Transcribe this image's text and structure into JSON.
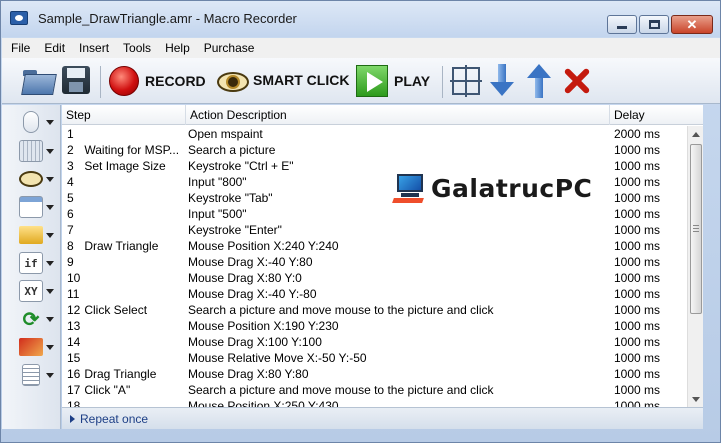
{
  "window": {
    "title": "Sample_DrawTriangle.amr - Macro Recorder",
    "controls": {
      "minimize": "minimize",
      "maximize": "maximize",
      "close": "✕"
    }
  },
  "menu": [
    "File",
    "Edit",
    "Insert",
    "Tools",
    "Help",
    "Purchase"
  ],
  "toolbar": {
    "open_icon": "folder-open-icon",
    "save_icon": "save-icon",
    "record_label": "RECORD",
    "smart_click_label": "SMART CLICK",
    "play_label": "PLAY",
    "select_icon": "select-icon",
    "move_down_icon": "arrow-down-icon",
    "move_up_icon": "arrow-up-icon",
    "delete_icon": "delete-icon"
  },
  "left_panel": {
    "buttons": [
      {
        "name": "mouse-icon",
        "glyph": ""
      },
      {
        "name": "keyboard-icon",
        "glyph": ""
      },
      {
        "name": "eye-icon",
        "glyph": ""
      },
      {
        "name": "window-icon",
        "glyph": ""
      },
      {
        "name": "folder-icon",
        "glyph": ""
      },
      {
        "name": "if-icon",
        "glyph": "if"
      },
      {
        "name": "xy-icon",
        "glyph": "XY"
      },
      {
        "name": "loop-icon",
        "glyph": "⟳"
      },
      {
        "name": "flag-icon",
        "glyph": ""
      },
      {
        "name": "note-icon",
        "glyph": ""
      }
    ]
  },
  "table": {
    "headers": {
      "step": "Step",
      "action": "Action Description",
      "delay": "Delay"
    },
    "rows": [
      {
        "num": "1",
        "label": "",
        "action": "Open mspaint",
        "delay": "2000 ms"
      },
      {
        "num": "2",
        "label": "Waiting for MSP...",
        "action": "Search a picture",
        "delay": "1000 ms"
      },
      {
        "num": "3",
        "label": "Set Image Size",
        "action": "Keystroke \"Ctrl + E\"",
        "delay": "1000 ms"
      },
      {
        "num": "4",
        "label": "",
        "action": "Input \"800\"",
        "delay": "1000 ms"
      },
      {
        "num": "5",
        "label": "",
        "action": "Keystroke \"Tab\"",
        "delay": "1000 ms"
      },
      {
        "num": "6",
        "label": "",
        "action": "Input \"500\"",
        "delay": "1000 ms"
      },
      {
        "num": "7",
        "label": "",
        "action": "Keystroke \"Enter\"",
        "delay": "1000 ms"
      },
      {
        "num": "8",
        "label": "Draw Triangle",
        "action": "Mouse Position X:240 Y:240",
        "delay": "1000 ms"
      },
      {
        "num": "9",
        "label": "",
        "action": "Mouse Drag X:-40 Y:80",
        "delay": "1000 ms"
      },
      {
        "num": "10",
        "label": "",
        "action": "Mouse Drag X:80 Y:0",
        "delay": "1000 ms"
      },
      {
        "num": "11",
        "label": "",
        "action": "Mouse Drag X:-40 Y:-80",
        "delay": "1000 ms"
      },
      {
        "num": "12",
        "label": "Click Select",
        "action": "Search a picture and move mouse to the picture and click",
        "delay": "1000 ms"
      },
      {
        "num": "13",
        "label": "",
        "action": "Mouse Position X:190 Y:230",
        "delay": "1000 ms"
      },
      {
        "num": "14",
        "label": "",
        "action": "Mouse Drag X:100 Y:100",
        "delay": "1000 ms"
      },
      {
        "num": "15",
        "label": "",
        "action": "Mouse Relative Move X:-50 Y:-50",
        "delay": "1000 ms"
      },
      {
        "num": "16",
        "label": "Drag Triangle",
        "action": "Mouse Drag X:80 Y:80",
        "delay": "1000 ms"
      },
      {
        "num": "17",
        "label": "Click \"A\"",
        "action": "Search a picture and move mouse to the picture and click",
        "delay": "1000 ms"
      },
      {
        "num": "18",
        "label": "",
        "action": "Mouse Position X:250 Y:430",
        "delay": "1000 ms"
      }
    ]
  },
  "status": {
    "repeat_label": "Repeat once"
  },
  "watermark": {
    "text": "GalatrucPC"
  }
}
